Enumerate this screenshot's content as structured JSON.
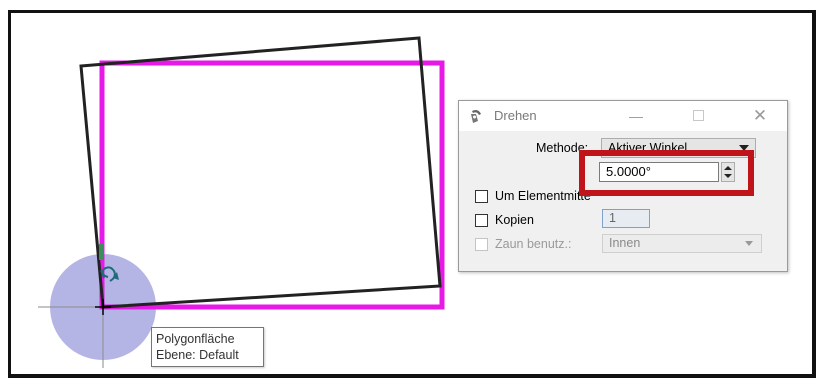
{
  "dialog": {
    "title": "Drehen",
    "methode_label": "Methode:",
    "methode_value": "Aktiver Winkel",
    "angle_value": "5.0000°",
    "um_elementmitte_label": "Um Elementmitte",
    "kopien_label": "Kopien",
    "kopien_value": "1",
    "zaun_label": "Zaun benutz.:",
    "zaun_value": "Innen"
  },
  "tooltip": {
    "line1": "Polygonfläche",
    "line2": "Ebene: Default"
  },
  "colors": {
    "polygon": "#e619e6",
    "rotated_outline": "#222222",
    "cursor_circle": "#a8a8e0",
    "highlight": "#c0141b"
  }
}
